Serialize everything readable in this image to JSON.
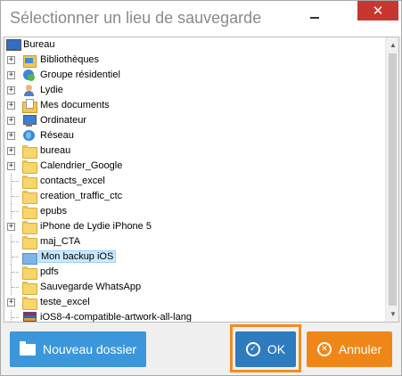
{
  "dialog": {
    "title": "Sélectionner un lieu de sauvegarde",
    "close_glyph": "✕"
  },
  "tree": {
    "root": {
      "label": "Bureau",
      "icon": "desktop-icon"
    },
    "items": [
      {
        "label": "Bibliothèques",
        "icon": "libraries-icon",
        "expandable": true,
        "selected": false
      },
      {
        "label": "Groupe résidentiel",
        "icon": "homegroup-icon",
        "expandable": true,
        "selected": false
      },
      {
        "label": "Lydie",
        "icon": "user-folder-icon",
        "expandable": true,
        "selected": false
      },
      {
        "label": "Mes documents",
        "icon": "documents-icon",
        "expandable": true,
        "selected": false
      },
      {
        "label": "Ordinateur",
        "icon": "computer-icon",
        "expandable": true,
        "selected": false
      },
      {
        "label": "Réseau",
        "icon": "network-icon",
        "expandable": true,
        "selected": false
      },
      {
        "label": "bureau",
        "icon": "folder-icon",
        "expandable": true,
        "selected": false
      },
      {
        "label": "Calendrier_Google",
        "icon": "folder-icon",
        "expandable": true,
        "selected": false
      },
      {
        "label": "contacts_excel",
        "icon": "folder-icon",
        "expandable": false,
        "selected": false
      },
      {
        "label": "creation_traffic_ctc",
        "icon": "folder-icon",
        "expandable": false,
        "selected": false
      },
      {
        "label": "epubs",
        "icon": "folder-icon",
        "expandable": false,
        "selected": false
      },
      {
        "label": "iPhone de Lydie iPhone 5",
        "icon": "folder-icon",
        "expandable": true,
        "selected": false
      },
      {
        "label": "maj_CTA",
        "icon": "folder-icon",
        "expandable": false,
        "selected": false
      },
      {
        "label": "Mon backup iOS",
        "icon": "folder-icon",
        "expandable": false,
        "selected": true
      },
      {
        "label": "pdfs",
        "icon": "folder-icon",
        "expandable": false,
        "selected": false
      },
      {
        "label": "Sauvegarde WhatsApp",
        "icon": "folder-icon",
        "expandable": false,
        "selected": false
      },
      {
        "label": "teste_excel",
        "icon": "folder-icon",
        "expandable": true,
        "selected": false
      },
      {
        "label": "iOS8-4-compatible-artwork-all-lang",
        "icon": "archive-icon",
        "expandable": false,
        "selected": false
      }
    ]
  },
  "buttons": {
    "new_folder": "Nouveau dossier",
    "ok": "OK",
    "cancel": "Annuler",
    "cancel_glyph": "✕",
    "ok_glyph": "✓"
  },
  "colors": {
    "accent_blue": "#3b97d9",
    "ok_blue": "#2f7bbf",
    "cancel_orange": "#ef8718",
    "highlight_orange": "#f28d1f",
    "close_red": "#c7372f",
    "selection": "#cce8ff"
  }
}
